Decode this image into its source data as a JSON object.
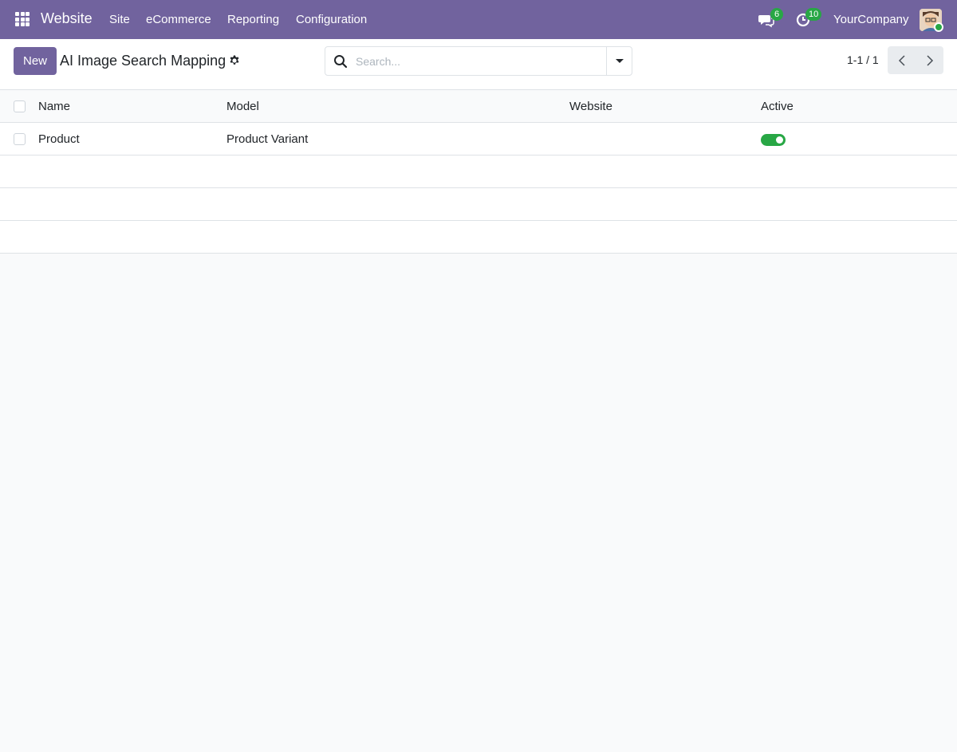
{
  "navbar": {
    "brand": "Website",
    "menu": [
      "Site",
      "eCommerce",
      "Reporting",
      "Configuration"
    ],
    "messages_count": "6",
    "activities_count": "10",
    "company": "YourCompany",
    "bg_color": "#71639e"
  },
  "control_panel": {
    "new_label": "New",
    "title": "AI Image Search Mapping",
    "search_placeholder": "Search...",
    "pager": "1-1 / 1"
  },
  "list": {
    "columns": [
      "Name",
      "Model",
      "Website",
      "Active"
    ],
    "rows": [
      {
        "name": "Product",
        "model": "Product Variant",
        "website": "",
        "active": true
      }
    ]
  },
  "colors": {
    "accent": "#71639e",
    "toggle_on": "#28a745"
  }
}
